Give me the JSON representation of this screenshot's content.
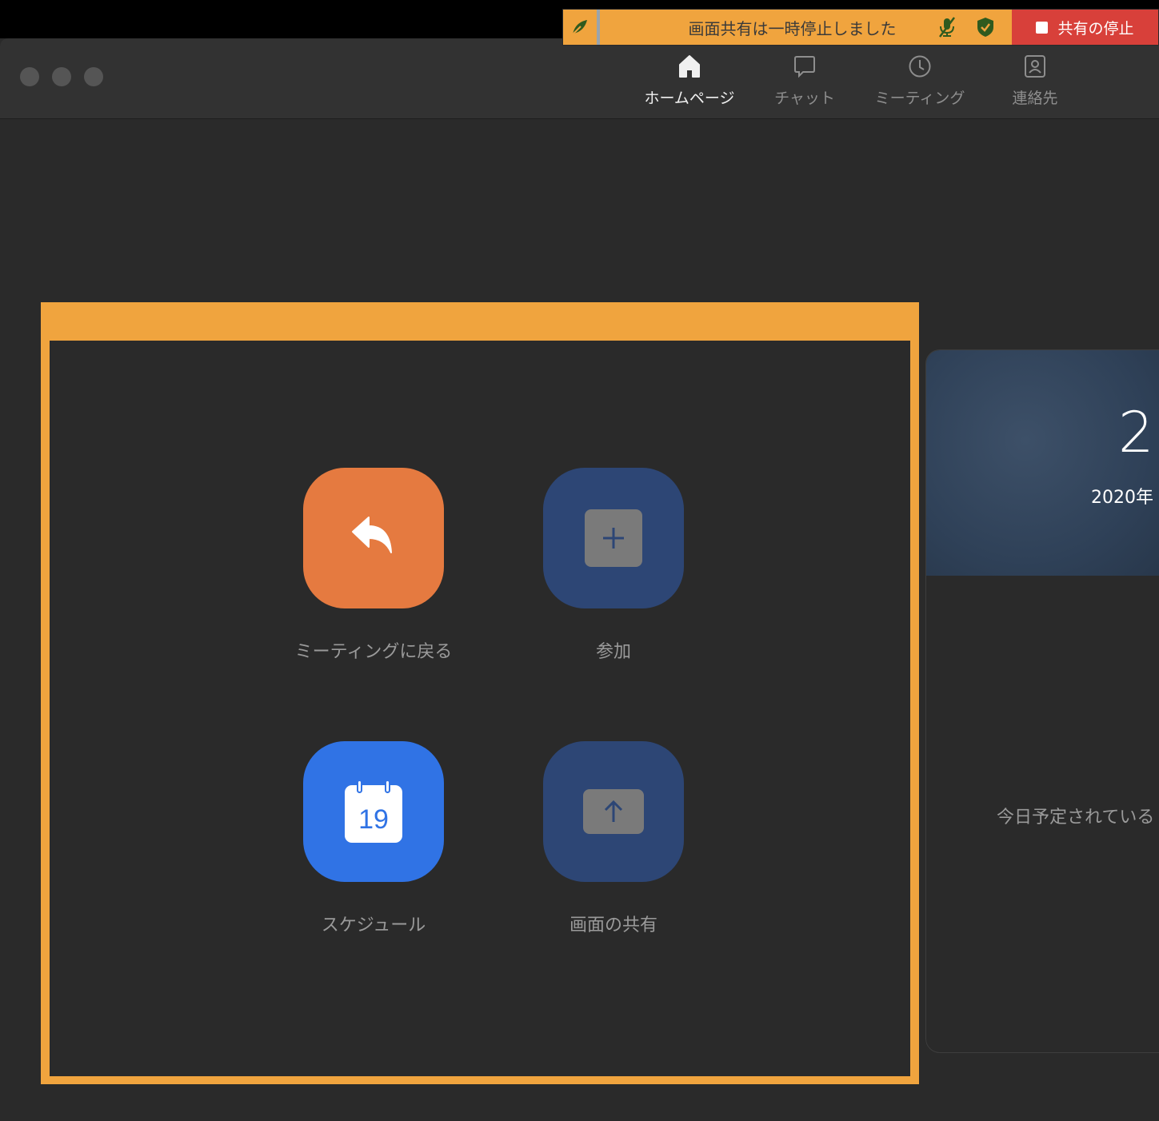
{
  "nav": {
    "items": [
      {
        "label": "ホームページ",
        "icon": "home-icon",
        "active": true
      },
      {
        "label": "チャット",
        "icon": "chat-icon",
        "active": false
      },
      {
        "label": "ミーティング",
        "icon": "clock-icon",
        "active": false
      },
      {
        "label": "連絡先",
        "icon": "contacts-icon",
        "active": false
      }
    ]
  },
  "share_bar": {
    "message": "画面共有は一時停止しました",
    "stop_label": "共有の停止",
    "color": "#f0a43e",
    "stop_color": "#d8403a"
  },
  "actions": {
    "rejoin": {
      "label": "ミーティングに戻る",
      "icon": "reply-arrow-icon",
      "color": "#e57a40"
    },
    "join": {
      "label": "参加",
      "icon": "plus-icon",
      "color": "#2d4675"
    },
    "schedule": {
      "label": "スケジュール",
      "icon": "calendar-icon",
      "day": "19",
      "color": "#3073e5"
    },
    "share": {
      "label": "画面の共有",
      "icon": "upload-arrow-icon",
      "color": "#2d4675"
    }
  },
  "calendar_card": {
    "time": "2",
    "date": "2020年",
    "empty_message": "今日予定されている"
  }
}
